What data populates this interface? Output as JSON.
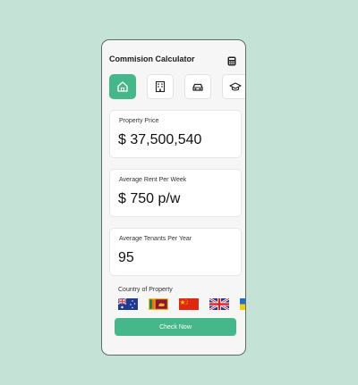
{
  "app": {
    "title": "Commision Calculator",
    "calculator_icon": "calculator-icon"
  },
  "categories": [
    {
      "icon": "home-icon",
      "active": true
    },
    {
      "icon": "building-icon",
      "active": false
    },
    {
      "icon": "car-icon",
      "active": false
    },
    {
      "icon": "graduation-cap-icon",
      "active": false
    }
  ],
  "fields": {
    "property_price": {
      "label": "Property Price",
      "value": "$ 37,500,540"
    },
    "average_rent": {
      "label": "Average Rent Per Week",
      "value": "$ 750 p/w"
    },
    "average_tenants": {
      "label": "Average Tenants Per Year",
      "value": "95"
    }
  },
  "country": {
    "label": "Country of Property",
    "flags": [
      "australia-flag",
      "sri-lanka-flag",
      "china-flag",
      "united-kingdom-flag",
      "ukraine-flag"
    ]
  },
  "actions": {
    "check_now": "Check Now"
  },
  "colors": {
    "background": "#c4e3d6",
    "accent": "#45b78a",
    "card": "#ffffff",
    "surface": "#f6f6f6"
  }
}
